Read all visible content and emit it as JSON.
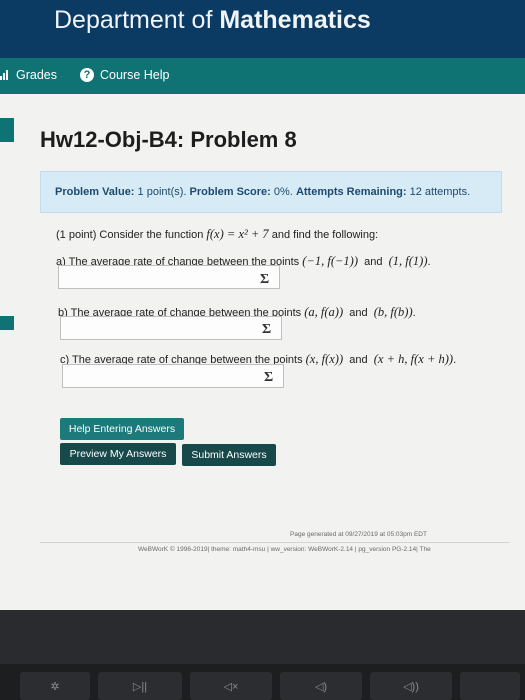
{
  "header": {
    "dept_prefix": "Department of ",
    "dept_bold": "Mathematics"
  },
  "nav": {
    "grades": "Grades",
    "course_help": "Course Help"
  },
  "title": "Hw12-Obj-B4: Problem 8",
  "info": {
    "value_label": "Problem Value:",
    "value": "1 point(s).",
    "score_label": "Problem Score:",
    "score": "0%.",
    "attempts_label": "Attempts Remaining:",
    "attempts": "12 attempts."
  },
  "problem": {
    "intro_before": "(1 point) Consider the function ",
    "function": "f(x) = x² + 7",
    "intro_after": " and find the following:",
    "a_text": "a) The average rate of change between the points ",
    "a_p1": "(−1, f(−1))",
    "a_p2": "(1, f(1))",
    "b_text": "b) The average rate of change between the points ",
    "b_p1": "(a, f(a))",
    "b_p2": "(b, f(b))",
    "c_text": "c) The average rate of change between the points ",
    "c_p1": "(x, f(x))",
    "c_p2": "(x + h, f(x + h))",
    "and": "and",
    "period": ".",
    "sigma": "Σ"
  },
  "buttons": {
    "help": "Help Entering Answers",
    "preview": "Preview My Answers",
    "submit": "Submit Answers"
  },
  "footer": {
    "generated": "Page generated at 09/27/2019 at 05:03pm EDT",
    "credits": "WeBWorK © 1996-2019| theme: math4-msu | ww_version: WeBWorK-2.14 | pg_version PG-2.14| The"
  },
  "keys": {
    "k1": "✲",
    "k2": "▷||",
    "k3": "◁×",
    "k4": "◁)",
    "k5": "◁))"
  }
}
